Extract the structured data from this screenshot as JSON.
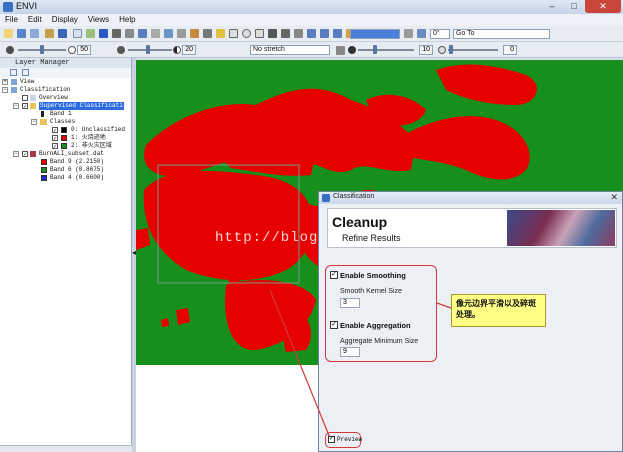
{
  "app": {
    "title": "ENVI"
  },
  "menu": [
    "File",
    "Edit",
    "Display",
    "Views",
    "Help"
  ],
  "toolbar": {
    "rotation": "0°",
    "goto_placeholder": "Go To"
  },
  "toolbar2": {
    "brightness": "50",
    "contrast": "20",
    "stretch": "No stretch",
    "sharpen": "10",
    "transparency": "0"
  },
  "layer_manager": {
    "title": "Layer Manager",
    "items": [
      {
        "label": "View"
      },
      {
        "label": "Classification"
      },
      {
        "label": "Overview"
      },
      {
        "label": "Supervised Classificati"
      },
      {
        "label": "Band 1"
      },
      {
        "label": "Classes"
      },
      {
        "label": "0: Unclassified",
        "color": "#000000"
      },
      {
        "label": "1: 火烧迹地",
        "color": "#e60000"
      },
      {
        "label": "2: 非火灾区域",
        "color": "#178f1d"
      },
      {
        "label": "BurnALI_subset.dat"
      },
      {
        "label": "Band 9 (2.2150)",
        "color": "#e60000"
      },
      {
        "label": "Band 6 (0.8675)",
        "color": "#178f1d"
      },
      {
        "label": "Band 4 (0.6600)",
        "color": "#1a2bd6"
      }
    ]
  },
  "watermark": "http://blog",
  "dialog": {
    "window_title": "Classification",
    "heading": "Cleanup",
    "subheading": "Refine Results",
    "smoothing": {
      "label": "Enable Smoothing",
      "checked": true,
      "kernel_label": "Smooth Kernel Size",
      "kernel_value": "3"
    },
    "aggregation": {
      "label": "Enable Aggregation",
      "checked": true,
      "min_label": "Aggregate Minimum Size",
      "min_value": "9"
    },
    "preview": {
      "label": "Preview",
      "checked": true
    }
  },
  "callout": "像元边界平滑以及碎斑处理。",
  "colors": {
    "burn": "#e60000",
    "nonfire": "#178f1d",
    "highlight": "#d03a3a"
  }
}
